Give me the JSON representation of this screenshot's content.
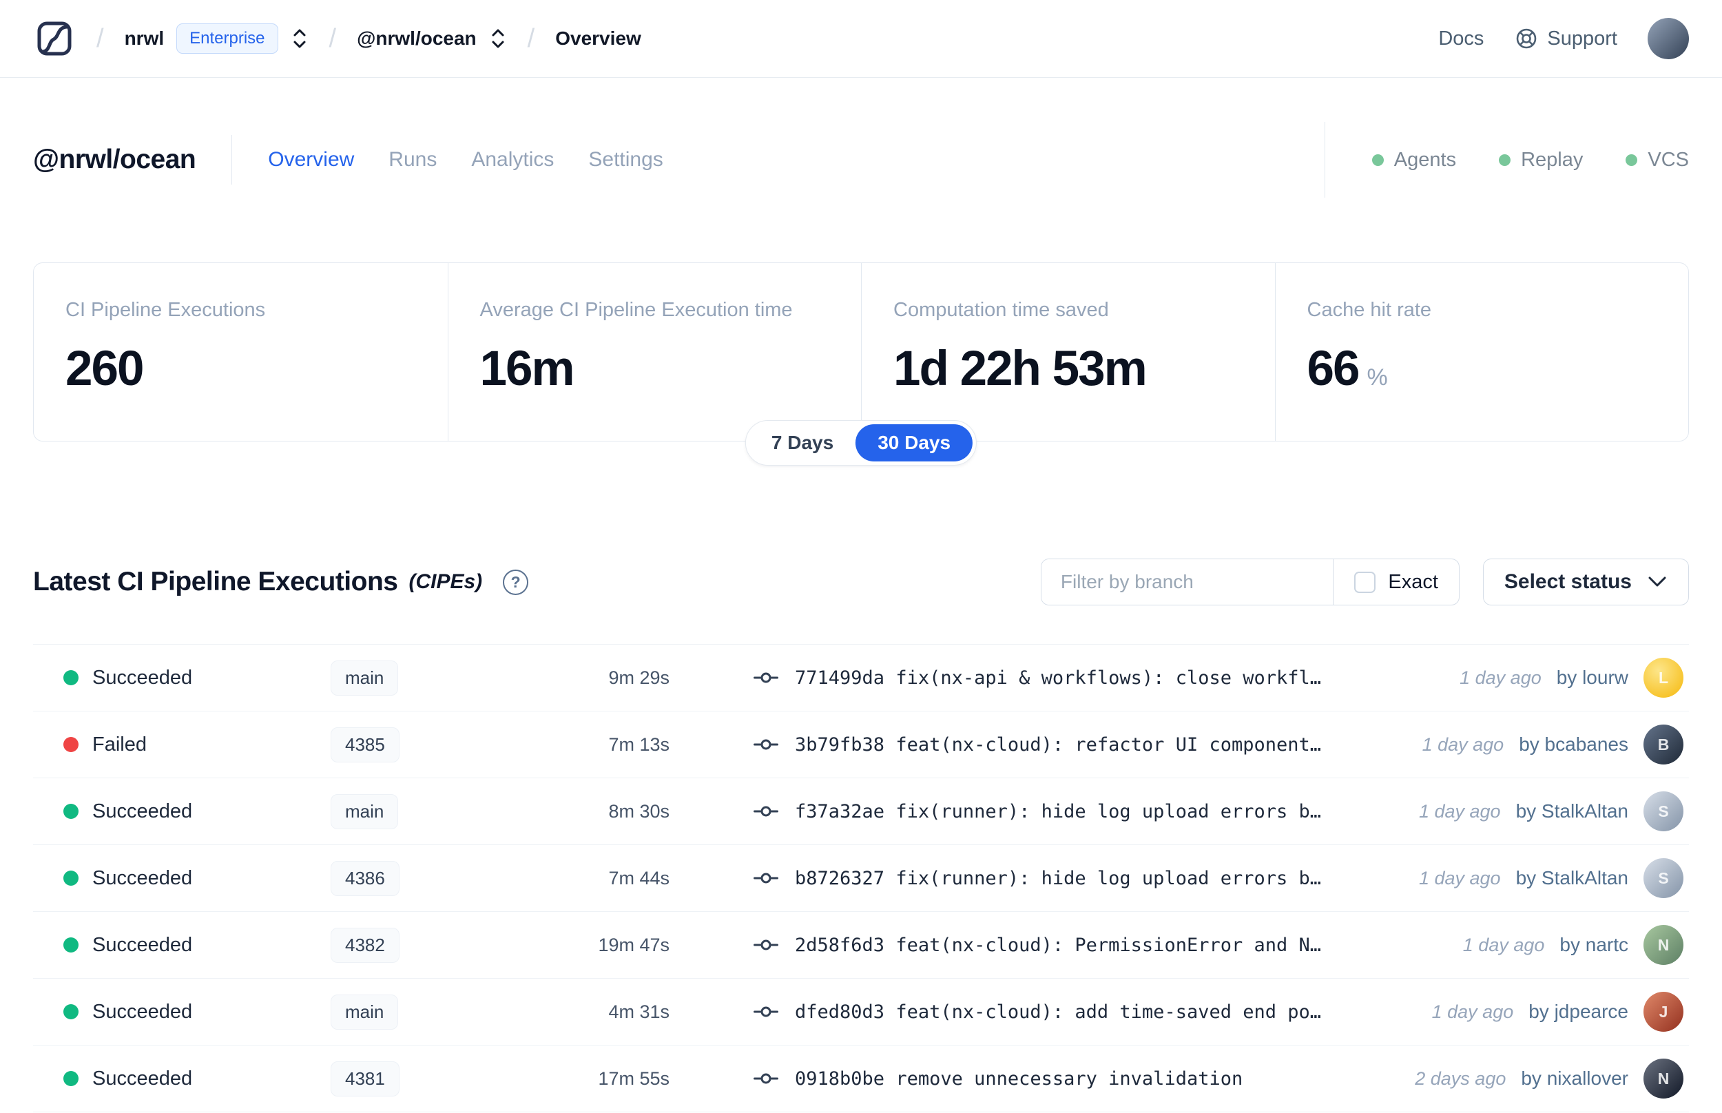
{
  "colors": {
    "accent": "#2563eb",
    "status": {
      "Succeeded": "#10b981",
      "Failed": "#ef4444"
    },
    "indicator_dot": "#79c79a"
  },
  "icons": {
    "logo": "nx-cloud-logo",
    "breadcrumb_selector": "chevron-up-down-icon",
    "support": "lifebuoy-icon",
    "help": "question-mark-circle-icon",
    "commit": "git-commit-icon",
    "select_chevron": "chevron-down-icon"
  },
  "navbar": {
    "org": "nrwl",
    "org_badge": "Enterprise",
    "workspace": "@nrwl/ocean",
    "page": "Overview",
    "docs_label": "Docs",
    "support_label": "Support",
    "user_avatar": {
      "initial": "",
      "bg": "linear-gradient(135deg,#94a3b8,#334155)"
    }
  },
  "header": {
    "title": "@nrwl/ocean",
    "tabs": [
      {
        "label": "Overview",
        "active": true
      },
      {
        "label": "Runs",
        "active": false
      },
      {
        "label": "Analytics",
        "active": false
      },
      {
        "label": "Settings",
        "active": false
      }
    ],
    "status_indicators": [
      {
        "label": "Agents"
      },
      {
        "label": "Replay"
      },
      {
        "label": "VCS"
      }
    ]
  },
  "stats": {
    "cards": [
      {
        "label": "CI Pipeline Executions",
        "value": "260",
        "suffix": ""
      },
      {
        "label": "Average CI Pipeline Execution time",
        "value": "16m",
        "suffix": ""
      },
      {
        "label": "Computation time saved",
        "value": "1d 22h 53m",
        "suffix": ""
      },
      {
        "label": "Cache hit rate",
        "value": "66",
        "suffix": "%"
      }
    ]
  },
  "range_toggle": {
    "options": [
      "7 Days",
      "30 Days"
    ],
    "active": "30 Days"
  },
  "section": {
    "title": "Latest CI Pipeline Executions",
    "subtitle": "(CIPEs)",
    "filter_placeholder": "Filter by branch",
    "exact_label": "Exact",
    "select_status_label": "Select status"
  },
  "table": {
    "rows": [
      {
        "status": "Succeeded",
        "branch": "main",
        "duration": "9m 29s",
        "hash": "771499da",
        "message": "fix(nx-api & workflows): close workfl…",
        "time_ago": "1 day ago",
        "author_label": "by lourw",
        "avatar": {
          "initial": "L",
          "bg": "radial-gradient(circle at 38% 32%, #fde68a, #f5b80b)"
        }
      },
      {
        "status": "Failed",
        "branch": "4385",
        "duration": "7m 13s",
        "hash": "3b79fb38",
        "message": "feat(nx-cloud): refactor UI component…",
        "time_ago": "1 day ago",
        "author_label": "by bcabanes",
        "avatar": {
          "initial": "B",
          "bg": "linear-gradient(135deg,#64748b,#1f2937)"
        }
      },
      {
        "status": "Succeeded",
        "branch": "main",
        "duration": "8m 30s",
        "hash": "f37a32ae",
        "message": "fix(runner): hide log upload errors b…",
        "time_ago": "1 day ago",
        "author_label": "by StalkAltan",
        "avatar": {
          "initial": "S",
          "bg": "linear-gradient(135deg,#d7dee8,#8494a8)"
        }
      },
      {
        "status": "Succeeded",
        "branch": "4386",
        "duration": "7m 44s",
        "hash": "b8726327",
        "message": "fix(runner): hide log upload errors b…",
        "time_ago": "1 day ago",
        "author_label": "by StalkAltan",
        "avatar": {
          "initial": "S",
          "bg": "linear-gradient(135deg,#d7dee8,#8494a8)"
        }
      },
      {
        "status": "Succeeded",
        "branch": "4382",
        "duration": "19m 47s",
        "hash": "2d58f6d3",
        "message": "feat(nx-cloud): PermissionError and N…",
        "time_ago": "1 day ago",
        "author_label": "by nartc",
        "avatar": {
          "initial": "N",
          "bg": "linear-gradient(135deg,#a8c8a0,#5d7f64)"
        }
      },
      {
        "status": "Succeeded",
        "branch": "main",
        "duration": "4m 31s",
        "hash": "dfed80d3",
        "message": "feat(nx-cloud): add time-saved end po…",
        "time_ago": "1 day ago",
        "author_label": "by jdpearce",
        "avatar": {
          "initial": "J",
          "bg": "linear-gradient(135deg,#e0896a,#93301f)"
        }
      },
      {
        "status": "Succeeded",
        "branch": "4381",
        "duration": "17m 55s",
        "hash": "0918b0be",
        "message": "remove unnecessary invalidation",
        "time_ago": "2 days ago",
        "author_label": "by nixallover",
        "avatar": {
          "initial": "N",
          "bg": "linear-gradient(135deg,#6b7280,#111827)"
        }
      }
    ]
  }
}
